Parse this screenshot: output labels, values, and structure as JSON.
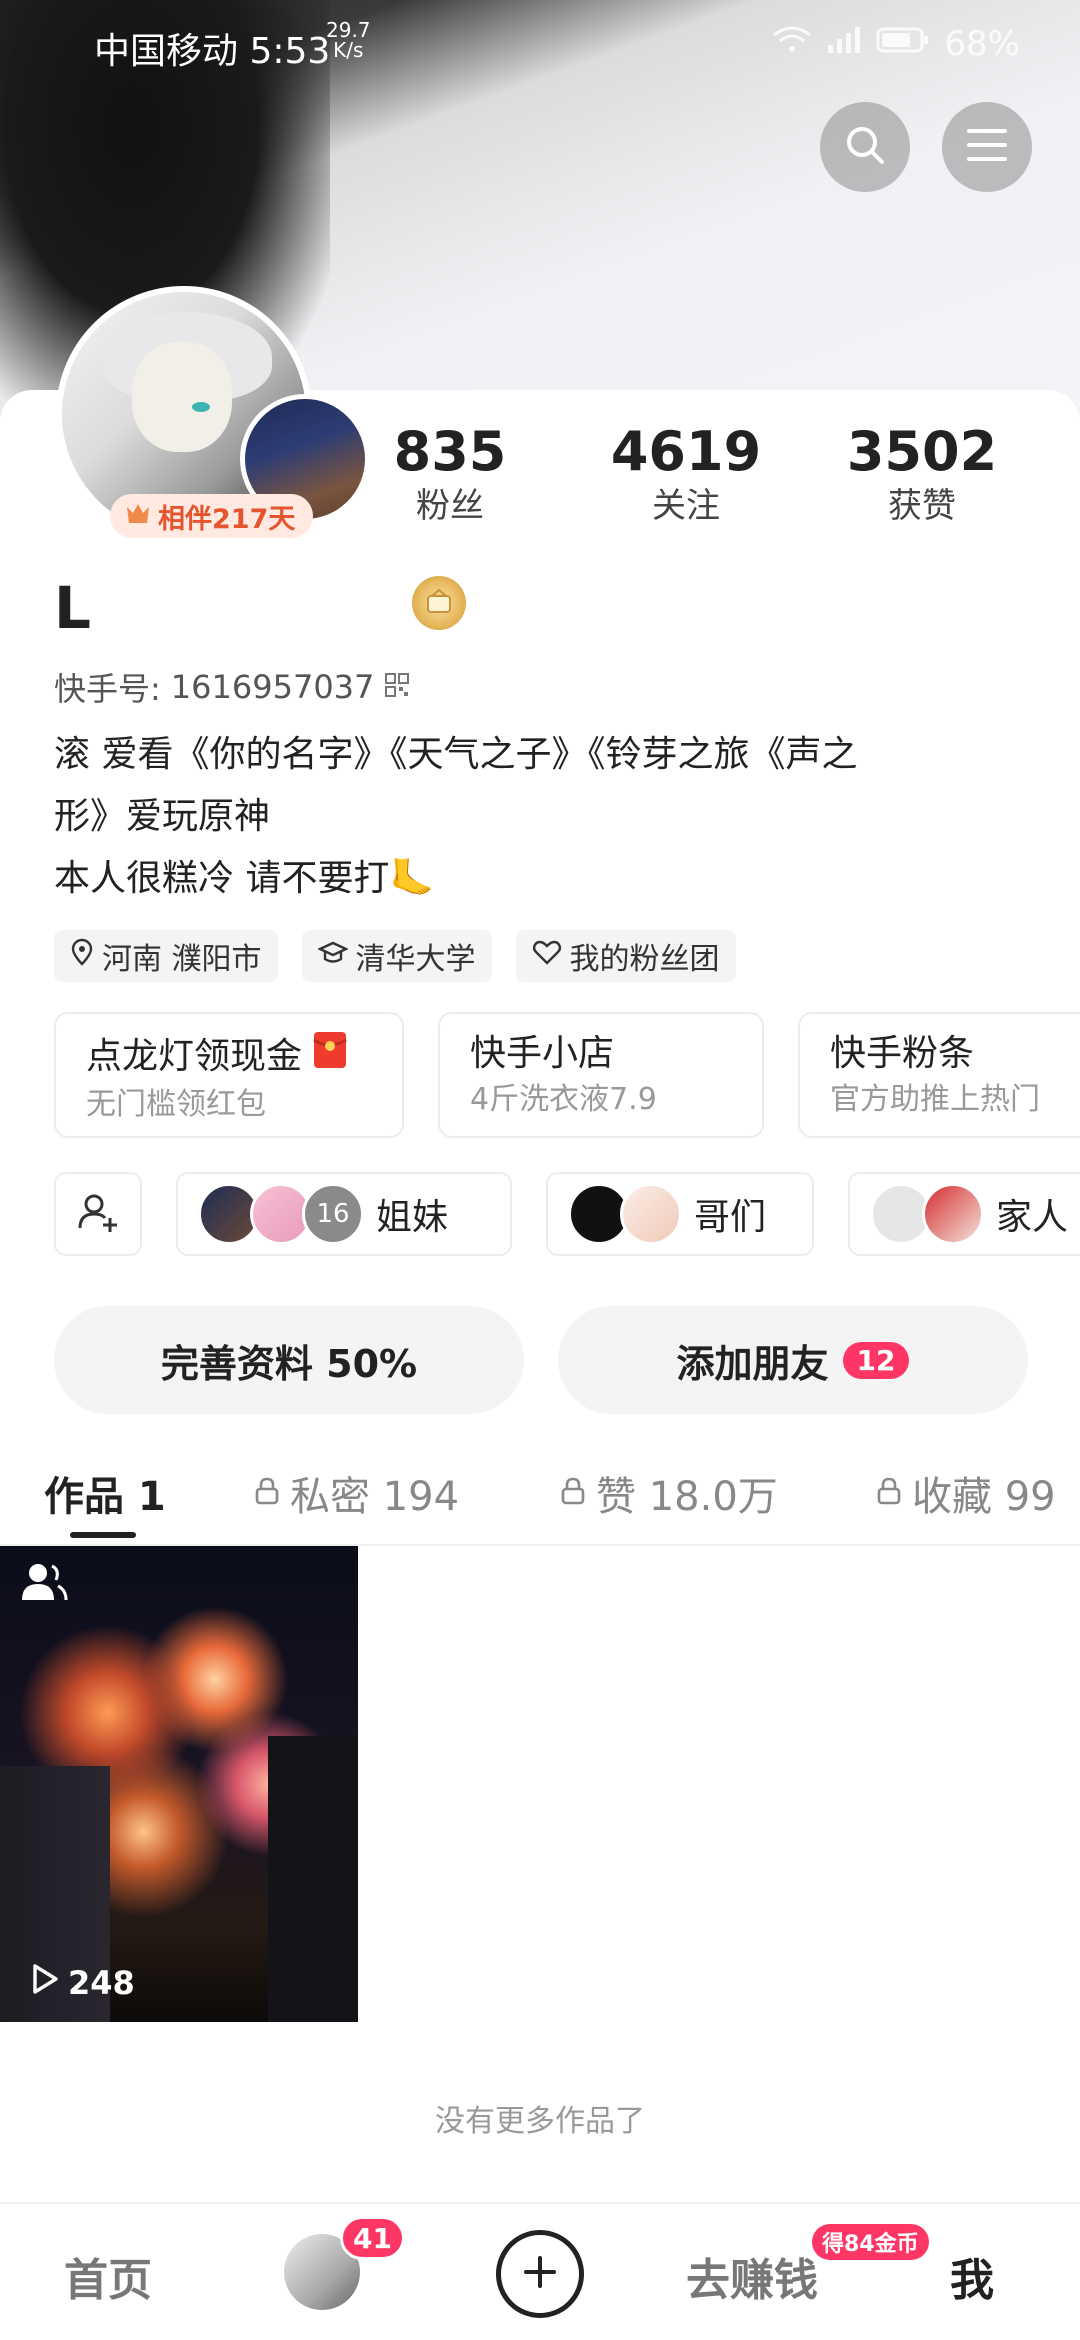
{
  "status_bar": {
    "carrier_time": "中国移动 5:53",
    "speed_value": "29.7",
    "speed_unit": "K/s",
    "battery": "68%"
  },
  "header": {
    "search_icon": "search-icon",
    "menu_icon": "menu-icon"
  },
  "profile": {
    "companion_badge": "相伴217天",
    "stats": [
      {
        "value": "835",
        "label": "粉丝"
      },
      {
        "value": "4619",
        "label": "关注"
      },
      {
        "value": "3502",
        "label": "获赞"
      }
    ],
    "name": "L",
    "kuaishou_id_label": "快手号:",
    "kuaishou_id": "1616957037",
    "bio_line1": "滚 爱看《你的名字》《天气之子》《铃芽之旅《声之",
    "bio_line2": "形》爱玩原神",
    "bio_line3": "本人很糕冷 请不要打🦶",
    "tags": [
      "河南 濮阳市",
      "清华大学",
      "我的粉丝团"
    ]
  },
  "cards": [
    {
      "title": "点龙灯领现金",
      "subtitle": "无门槛领红包"
    },
    {
      "title": "快手小店",
      "subtitle": "4斤洗衣液7.9"
    },
    {
      "title": "快手粉条",
      "subtitle": "官方助推上热门"
    }
  ],
  "groups": [
    {
      "label": "姐妹",
      "count": "16"
    },
    {
      "label": "哥们"
    },
    {
      "label": "家人"
    }
  ],
  "actions": {
    "complete_profile": "完善资料 50%",
    "add_friends": "添加朋友",
    "add_friends_count": "12"
  },
  "tabs": [
    {
      "label": "作品 1"
    },
    {
      "label": "私密 194"
    },
    {
      "label": "赞 18.0万"
    },
    {
      "label": "收藏 99"
    }
  ],
  "works": [
    {
      "play_count": "248"
    }
  ],
  "no_more": "没有更多作品了",
  "bottom_nav": {
    "home": "首页",
    "notif_count": "41",
    "earn": "去赚钱",
    "earn_badge": "得84金币",
    "me": "我"
  }
}
